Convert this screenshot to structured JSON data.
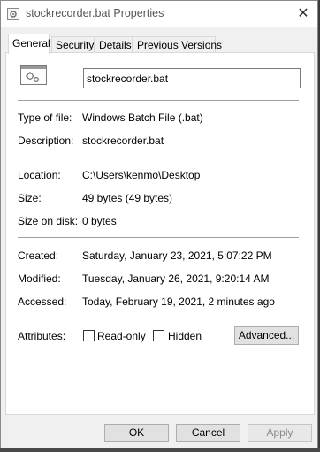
{
  "window": {
    "title": "stockrecorder.bat Properties",
    "close_glyph": "✕"
  },
  "tabs": [
    {
      "label": "General",
      "active": true
    },
    {
      "label": "Security",
      "active": false
    },
    {
      "label": "Details",
      "active": false
    },
    {
      "label": "Previous Versions",
      "active": false
    }
  ],
  "general": {
    "file_name": "stockrecorder.bat",
    "type_label": "Type of file:",
    "type_value": "Windows Batch File (.bat)",
    "description_label": "Description:",
    "description_value": "stockrecorder.bat",
    "location_label": "Location:",
    "location_value": "C:\\Users\\kenmo\\Desktop",
    "size_label": "Size:",
    "size_value": "49 bytes (49 bytes)",
    "size_on_disk_label": "Size on disk:",
    "size_on_disk_value": "0 bytes",
    "created_label": "Created:",
    "created_value": "Saturday, January 23, 2021, 5:07:22 PM",
    "modified_label": "Modified:",
    "modified_value": "Tuesday, January 26, 2021, 9:20:14 AM",
    "accessed_label": "Accessed:",
    "accessed_value": "Today, February 19, 2021, 2 minutes ago",
    "attributes_label": "Attributes:",
    "readonly_label": "Read-only",
    "readonly_checked": false,
    "hidden_label": "Hidden",
    "hidden_checked": false,
    "advanced_label": "Advanced..."
  },
  "buttons": {
    "ok": "OK",
    "cancel": "Cancel",
    "apply": "Apply"
  },
  "icons": {
    "title_icon": "batch-file-icon",
    "file_icon": "gear-file-icon"
  }
}
